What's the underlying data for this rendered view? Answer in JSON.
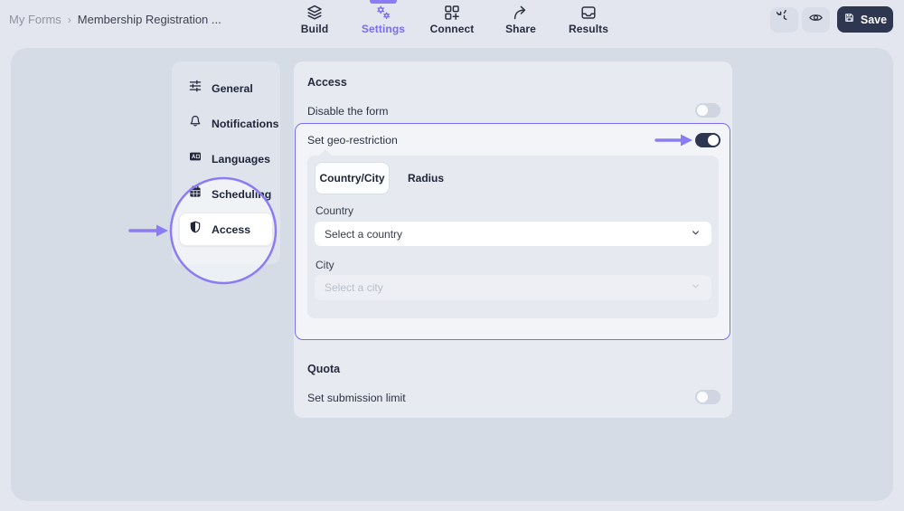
{
  "breadcrumb": {
    "root": "My Forms",
    "separator": "›",
    "current": "Membership Registration ..."
  },
  "nav": {
    "tabs": [
      {
        "label": "Build",
        "active": false
      },
      {
        "label": "Settings",
        "active": true
      },
      {
        "label": "Connect",
        "active": false
      },
      {
        "label": "Share",
        "active": false
      },
      {
        "label": "Results",
        "active": false
      }
    ]
  },
  "topbar": {
    "save_label": "Save"
  },
  "sidebar": {
    "items": [
      {
        "label": "General",
        "icon": "sliders-icon",
        "active": false
      },
      {
        "label": "Notifications",
        "icon": "bell-icon",
        "active": false
      },
      {
        "label": "Languages",
        "icon": "translate-icon",
        "active": false
      },
      {
        "label": "Scheduling",
        "icon": "calendar-icon",
        "active": false
      },
      {
        "label": "Access",
        "icon": "shield-icon",
        "active": true
      }
    ]
  },
  "main": {
    "access": {
      "title": "Access",
      "disable_form": {
        "label": "Disable the form",
        "enabled": false
      },
      "geo": {
        "label": "Set geo-restriction",
        "enabled": true,
        "tabs": [
          {
            "label": "Country/City",
            "active": true
          },
          {
            "label": "Radius",
            "active": false
          }
        ],
        "country": {
          "label": "Country",
          "value": "Select a country"
        },
        "city": {
          "label": "City",
          "placeholder": "Select a city",
          "disabled": true
        }
      }
    },
    "quota": {
      "title": "Quota",
      "submission_limit": {
        "label": "Set submission limit",
        "enabled": false
      }
    }
  },
  "colors": {
    "accent_purple": "#7b6cf0",
    "annotation_purple": "#8b7cf6",
    "toggle_on": "#2d3550",
    "save_button_bg": "#2e3650",
    "page_bg": "#e3e6ee",
    "container_bg": "#d6dce6"
  }
}
